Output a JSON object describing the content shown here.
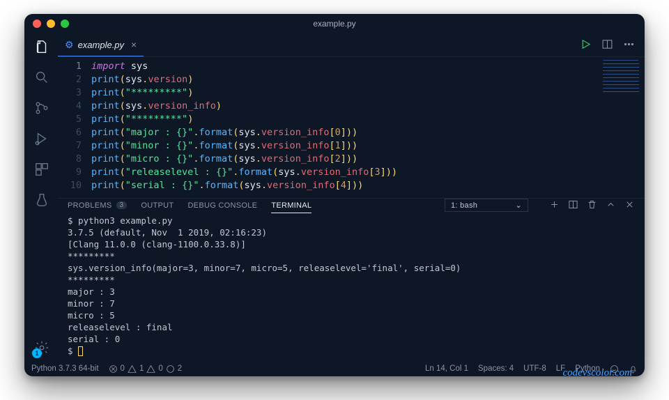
{
  "window": {
    "title": "example.py"
  },
  "tab": {
    "filename": "example.py"
  },
  "code": {
    "lines": [
      [
        [
          "kw",
          "import"
        ],
        [
          "obj",
          " sys"
        ]
      ],
      [
        [
          "fn",
          "print"
        ],
        [
          "punc",
          "("
        ],
        [
          "obj",
          "sys"
        ],
        [
          "punc",
          "."
        ],
        [
          "prop",
          "version"
        ],
        [
          "punc",
          ")"
        ]
      ],
      [
        [
          "fn",
          "print"
        ],
        [
          "punc",
          "("
        ],
        [
          "str",
          "\"*********\""
        ],
        [
          "punc",
          ")"
        ]
      ],
      [
        [
          "fn",
          "print"
        ],
        [
          "punc",
          "("
        ],
        [
          "obj",
          "sys"
        ],
        [
          "punc",
          "."
        ],
        [
          "prop",
          "version_info"
        ],
        [
          "punc",
          ")"
        ]
      ],
      [
        [
          "fn",
          "print"
        ],
        [
          "punc",
          "("
        ],
        [
          "str",
          "\"*********\""
        ],
        [
          "punc",
          ")"
        ]
      ],
      [
        [
          "fn",
          "print"
        ],
        [
          "punc",
          "("
        ],
        [
          "str",
          "\"major : {}\""
        ],
        [
          "punc",
          "."
        ],
        [
          "fn",
          "format"
        ],
        [
          "punc",
          "("
        ],
        [
          "obj",
          "sys"
        ],
        [
          "punc",
          "."
        ],
        [
          "prop",
          "version_info"
        ],
        [
          "punc",
          "["
        ],
        [
          "num",
          "0"
        ],
        [
          "punc",
          "]))"
        ]
      ],
      [
        [
          "fn",
          "print"
        ],
        [
          "punc",
          "("
        ],
        [
          "str",
          "\"minor : {}\""
        ],
        [
          "punc",
          "."
        ],
        [
          "fn",
          "format"
        ],
        [
          "punc",
          "("
        ],
        [
          "obj",
          "sys"
        ],
        [
          "punc",
          "."
        ],
        [
          "prop",
          "version_info"
        ],
        [
          "punc",
          "["
        ],
        [
          "num",
          "1"
        ],
        [
          "punc",
          "]))"
        ]
      ],
      [
        [
          "fn",
          "print"
        ],
        [
          "punc",
          "("
        ],
        [
          "str",
          "\"micro : {}\""
        ],
        [
          "punc",
          "."
        ],
        [
          "fn",
          "format"
        ],
        [
          "punc",
          "("
        ],
        [
          "obj",
          "sys"
        ],
        [
          "punc",
          "."
        ],
        [
          "prop",
          "version_info"
        ],
        [
          "punc",
          "["
        ],
        [
          "num",
          "2"
        ],
        [
          "punc",
          "]))"
        ]
      ],
      [
        [
          "fn",
          "print"
        ],
        [
          "punc",
          "("
        ],
        [
          "str",
          "\"releaselevel : {}\""
        ],
        [
          "punc",
          "."
        ],
        [
          "fn",
          "format"
        ],
        [
          "punc",
          "("
        ],
        [
          "obj",
          "sys"
        ],
        [
          "punc",
          "."
        ],
        [
          "prop",
          "version_info"
        ],
        [
          "punc",
          "["
        ],
        [
          "num",
          "3"
        ],
        [
          "punc",
          "]))"
        ]
      ],
      [
        [
          "fn",
          "print"
        ],
        [
          "punc",
          "("
        ],
        [
          "str",
          "\"serial : {}\""
        ],
        [
          "punc",
          "."
        ],
        [
          "fn",
          "format"
        ],
        [
          "punc",
          "("
        ],
        [
          "obj",
          "sys"
        ],
        [
          "punc",
          "."
        ],
        [
          "prop",
          "version_info"
        ],
        [
          "punc",
          "["
        ],
        [
          "num",
          "4"
        ],
        [
          "punc",
          "]))"
        ]
      ]
    ]
  },
  "panel": {
    "tabs": {
      "problems": "PROBLEMS",
      "problems_count": "3",
      "output": "OUTPUT",
      "debug": "DEBUG CONSOLE",
      "terminal": "TERMINAL"
    },
    "picker": "1: bash"
  },
  "terminal_output": "$ python3 example.py\n3.7.5 (default, Nov  1 2019, 02:16:23)\n[Clang 11.0.0 (clang-1100.0.33.8)]\n*********\nsys.version_info(major=3, minor=7, micro=5, releaselevel='final', serial=0)\n*********\nmajor : 3\nminor : 7\nmicro : 5\nreleaselevel : final\nserial : 0\n$ ",
  "watermark": "codevscolor.com",
  "statusbar": {
    "python": "Python 3.7.3 64-bit",
    "errors": "0",
    "warn_a": "1",
    "warn_b": "0",
    "info": "2",
    "lncol": "Ln 14, Col 1",
    "spaces": "Spaces: 4",
    "enc": "UTF-8",
    "eol": "LF",
    "lang": "Python"
  },
  "gear_badge": "1"
}
